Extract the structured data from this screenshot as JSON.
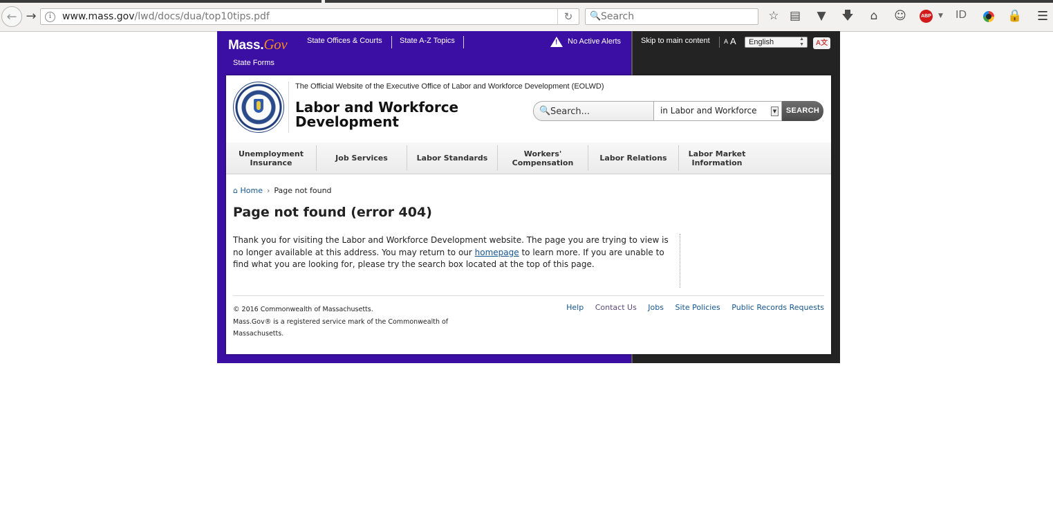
{
  "browser": {
    "url_host": "www.mass.gov",
    "url_path": "/lwd/docs/dua/top10tips.pdf",
    "search_placeholder": "Search",
    "abp_label": "ABP",
    "id_label": "ID"
  },
  "site": {
    "logo_mass": "Mass.",
    "logo_gov": "Gov",
    "top_links": [
      "State Offices & Courts",
      "State A-Z Topics",
      "State Forms"
    ],
    "alert_text": "No Active Alerts",
    "skip_link": "Skip to main content",
    "font_small": "A",
    "font_large": "A",
    "language": "English",
    "translate_label": "A文"
  },
  "header": {
    "official_text": "The Official Website of the Executive Office of Labor and Workforce Development (EOLWD)",
    "site_title": "Labor and Workforce Development",
    "search_placeholder": "Search...",
    "search_scope": "in Labor and Workforce",
    "search_button": "SEARCH"
  },
  "nav": {
    "items": [
      {
        "label": "Unemployment Insurance"
      },
      {
        "label": "Job Services"
      },
      {
        "label": "Labor Standards"
      },
      {
        "label": "Workers' Compensation"
      },
      {
        "label": "Labor Relations"
      },
      {
        "label": "Labor Market Information"
      }
    ]
  },
  "content": {
    "breadcrumb_home": "Home",
    "breadcrumb_current": "Page not found",
    "page_title": "Page not found (error 404)",
    "body_before_link": "Thank you for visiting the Labor and Workforce Development website. The page you are trying to view is no longer available at this address. You may return to our ",
    "body_link": "homepage",
    "body_after_link": " to learn more. If you are unable to find what you are looking for, please try the search box located at the top of this page."
  },
  "footer": {
    "copyright": "© 2016 Commonwealth of Massachusetts.",
    "trademark": "Mass.Gov® is a registered service mark of the Commonwealth of Massachusetts.",
    "links": [
      "Help",
      "Contact Us",
      "Jobs",
      "Site Policies",
      "Public Records Requests"
    ]
  }
}
